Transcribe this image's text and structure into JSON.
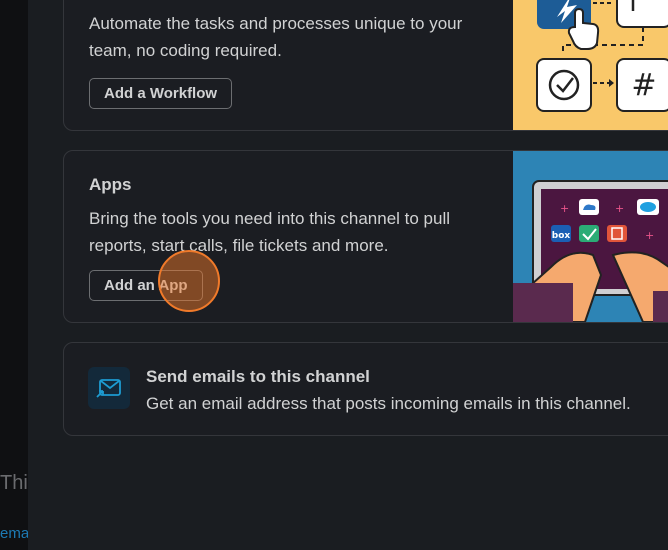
{
  "background": {
    "partial_text": "Thi",
    "partial_link": "email"
  },
  "workflow_card": {
    "description": "Automate the tasks and processes unique to your team, no coding required.",
    "button_label": "Add a Workflow",
    "illustration_hashtag": "#"
  },
  "apps_card": {
    "title": "Apps",
    "description": "Bring the tools you need into this channel to pull reports, start calls, file tickets and more.",
    "button_label": "Add an App",
    "illustration_box_label": "box"
  },
  "email_card": {
    "title": "Send emails to this channel",
    "description": "Get an email address that posts incoming emails in this channel."
  },
  "colors": {
    "accent_click": "#f07a2a",
    "workflow_illustration_bg": "#f9c86a",
    "apps_illustration_bg": "#2d84b5"
  },
  "icons": [
    "lightning-icon",
    "pointer-hand-icon",
    "checkmark-circle-icon",
    "hashtag-icon",
    "email-forward-icon"
  ]
}
